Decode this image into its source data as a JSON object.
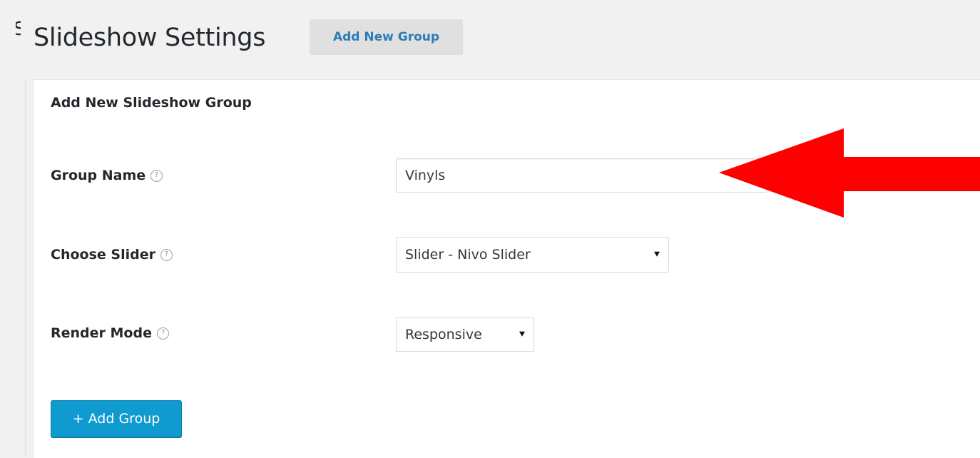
{
  "header": {
    "title": "Slideshow Settings",
    "add_new_label": "Add New Group"
  },
  "panel": {
    "heading": "Add New Slideshow Group",
    "fields": [
      {
        "label": "Group Name",
        "help": "?",
        "value": "Vinyls"
      },
      {
        "label": "Choose Slider",
        "help": "?",
        "value": "Slider - Nivo Slider"
      },
      {
        "label": "Render Mode",
        "help": "?",
        "value": "Responsive"
      }
    ],
    "submit_label": "+ Add Group"
  },
  "annotation": {
    "arrow_color": "#ff0000"
  },
  "colors": {
    "background": "#f1f1f1",
    "accent_button": "#0f9ad0",
    "link_text": "#2a7db5"
  }
}
